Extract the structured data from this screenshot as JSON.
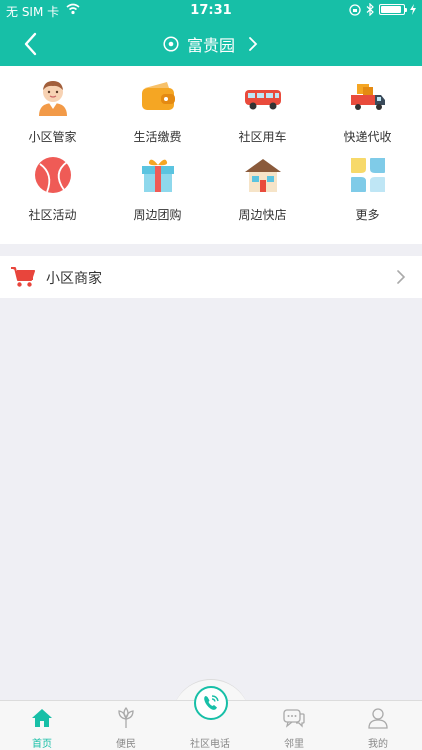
{
  "status_bar": {
    "carrier": "无 SIM 卡",
    "time": "17:31",
    "battery_level": 0.9
  },
  "nav": {
    "title": "富贵园"
  },
  "services": [
    {
      "label": "小区管家",
      "icon": "butler-icon"
    },
    {
      "label": "生活缴费",
      "icon": "wallet-icon"
    },
    {
      "label": "社区用车",
      "icon": "car-icon"
    },
    {
      "label": "快递代收",
      "icon": "delivery-truck-icon"
    },
    {
      "label": "社区活动",
      "icon": "ball-icon"
    },
    {
      "label": "周边团购",
      "icon": "gift-icon"
    },
    {
      "label": "周边快店",
      "icon": "shop-icon"
    },
    {
      "label": "更多",
      "icon": "more-icon"
    }
  ],
  "merchant": {
    "label": "小区商家"
  },
  "tabbar": {
    "tabs": [
      {
        "label": "首页",
        "icon": "home-icon",
        "active": true
      },
      {
        "label": "便民",
        "icon": "plant-icon",
        "active": false
      },
      {
        "label": "社区电话",
        "icon": "phone-icon",
        "active": false
      },
      {
        "label": "邻里",
        "icon": "chat-icon",
        "active": false
      },
      {
        "label": "我的",
        "icon": "person-icon",
        "active": false
      }
    ]
  },
  "colors": {
    "accent": "#17bfa7"
  }
}
